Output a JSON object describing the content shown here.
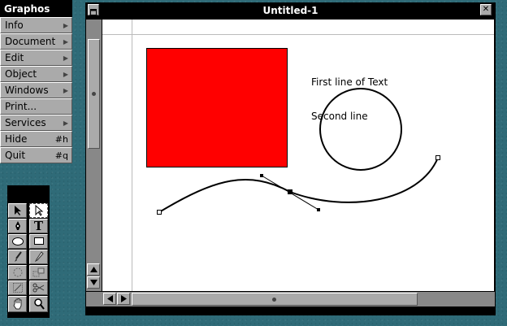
{
  "menu": {
    "title": "Graphos",
    "items": [
      {
        "label": "Info",
        "submenu": true,
        "shortcut": ""
      },
      {
        "label": "Document",
        "submenu": true,
        "shortcut": ""
      },
      {
        "label": "Edit",
        "submenu": true,
        "shortcut": ""
      },
      {
        "label": "Object",
        "submenu": true,
        "shortcut": ""
      },
      {
        "label": "Windows",
        "submenu": true,
        "shortcut": ""
      },
      {
        "label": "Print...",
        "submenu": false,
        "shortcut": ""
      },
      {
        "label": "Services",
        "submenu": true,
        "shortcut": ""
      },
      {
        "label": "Hide",
        "submenu": false,
        "shortcut": "#h"
      },
      {
        "label": "Quit",
        "submenu": false,
        "shortcut": "#q"
      }
    ],
    "submenu_glyph": "▶"
  },
  "tools": {
    "items": [
      {
        "name": "arrow-tool",
        "selected": false
      },
      {
        "name": "direct-select-tool",
        "selected": true
      },
      {
        "name": "pen-tool",
        "selected": false
      },
      {
        "name": "text-tool",
        "selected": false,
        "glyph": "T"
      },
      {
        "name": "ellipse-tool",
        "selected": false
      },
      {
        "name": "rectangle-tool",
        "selected": false
      },
      {
        "name": "brush-tool",
        "selected": false
      },
      {
        "name": "pencil-tool",
        "selected": false
      },
      {
        "name": "rotate-tool",
        "selected": false
      },
      {
        "name": "reflect-tool",
        "selected": false
      },
      {
        "name": "scale-tool",
        "selected": false
      },
      {
        "name": "scissors-tool",
        "selected": false
      },
      {
        "name": "hand-tool",
        "selected": false
      },
      {
        "name": "zoom-tool",
        "selected": false
      }
    ]
  },
  "window": {
    "title": "Untitled-1",
    "close_glyph": "✕"
  },
  "canvas": {
    "text_lines": [
      "First line of Text",
      "Second line"
    ],
    "rect_fill": "#ff0000"
  },
  "colors": {
    "desktop": "#2f6b78",
    "panel": "#aaaaaa",
    "titlebar": "#000000"
  }
}
